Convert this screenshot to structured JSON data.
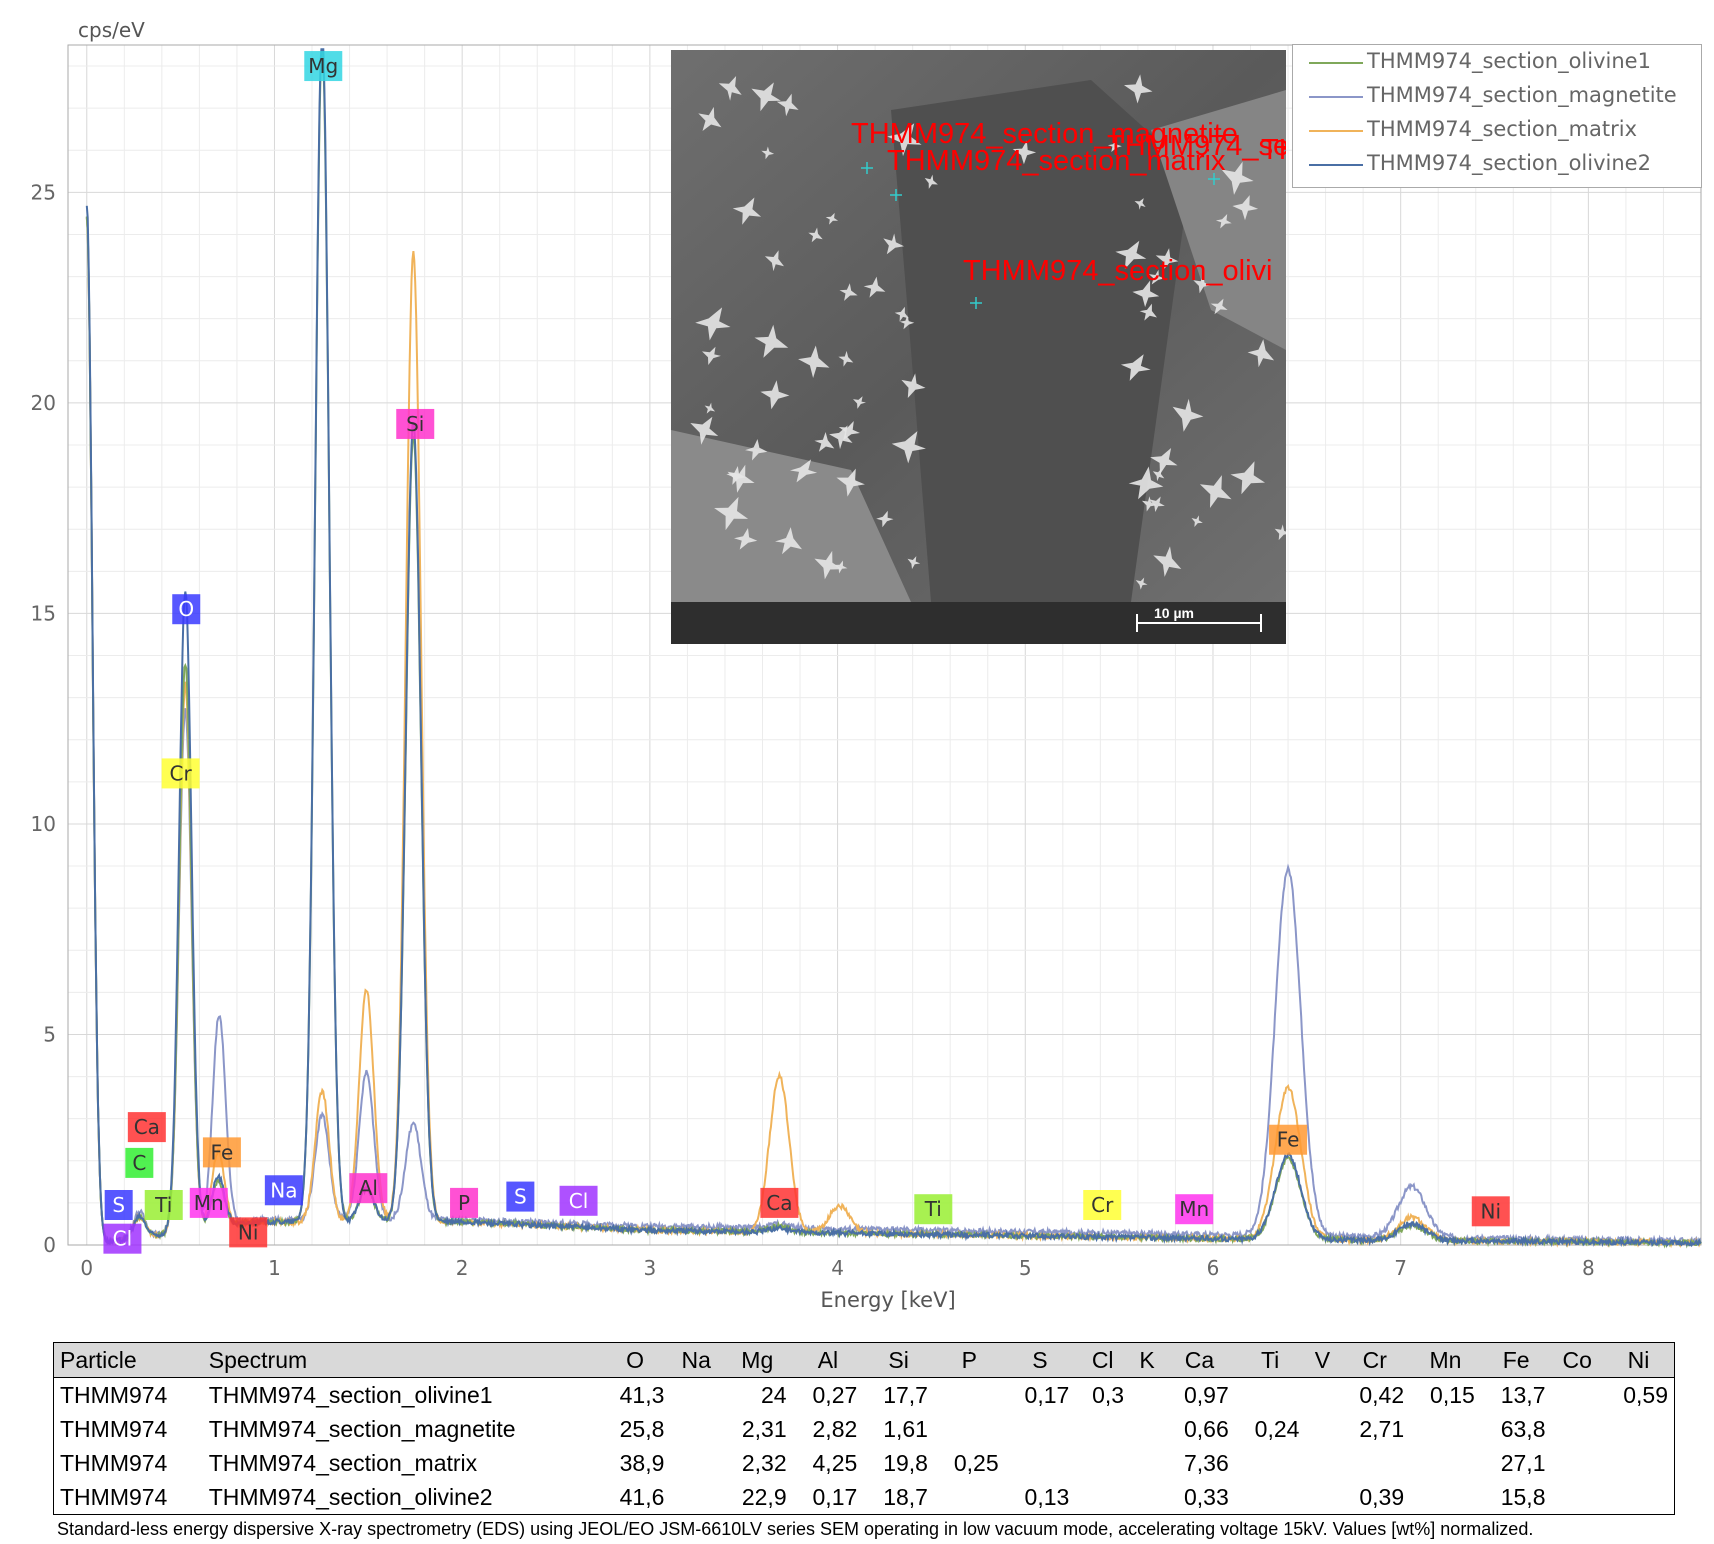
{
  "chart_data": {
    "type": "line",
    "ylabel": "cps/eV",
    "xlabel": "Energy [keV]",
    "xlim": [
      -0.1,
      8.6
    ],
    "ylim": [
      0,
      28.5
    ],
    "x_ticks": [
      "0",
      "1",
      "2",
      "3",
      "4",
      "5",
      "6",
      "7",
      "8"
    ],
    "y_ticks": [
      "0",
      "5",
      "10",
      "15",
      "20",
      "25"
    ],
    "grid": true,
    "legend_position": "top-right",
    "series": [
      {
        "name": "THMM974_section_olivine1",
        "color": "#7fa85a",
        "peaks": [
          [
            0,
            24.4
          ],
          [
            0.28,
            0.5
          ],
          [
            0.525,
            13.5
          ],
          [
            0.7,
            1.1
          ],
          [
            1.254,
            28.0
          ],
          [
            1.49,
            0.8
          ],
          [
            1.74,
            18.7
          ],
          [
            3.69,
            0.15
          ],
          [
            6.4,
            1.9
          ],
          [
            7.06,
            0.35
          ]
        ],
        "background": [
          [
            0.9,
            0.55
          ],
          [
            2.0,
            0.55
          ],
          [
            3.0,
            0.35
          ],
          [
            4.5,
            0.25
          ],
          [
            6.0,
            0.15
          ],
          [
            8.6,
            0.05
          ]
        ]
      },
      {
        "name": "THMM974_section_magnetite",
        "color": "#8b96c8",
        "peaks": [
          [
            0,
            24.4
          ],
          [
            0.28,
            0.6
          ],
          [
            0.525,
            12.4
          ],
          [
            0.705,
            5.0
          ],
          [
            1.254,
            2.5
          ],
          [
            1.49,
            3.5
          ],
          [
            1.74,
            2.3
          ],
          [
            3.69,
            0.1
          ],
          [
            6.4,
            8.7
          ],
          [
            7.06,
            1.2
          ]
        ],
        "background": [
          [
            0.9,
            0.6
          ],
          [
            2.0,
            0.6
          ],
          [
            3.0,
            0.45
          ],
          [
            4.5,
            0.35
          ],
          [
            6.0,
            0.25
          ],
          [
            8.6,
            0.1
          ]
        ]
      },
      {
        "name": "THMM974_section_matrix",
        "color": "#f0b35a",
        "peaks": [
          [
            0,
            24.4
          ],
          [
            0.28,
            0.5
          ],
          [
            0.525,
            13.0
          ],
          [
            0.7,
            1.8
          ],
          [
            1.254,
            3.1
          ],
          [
            1.49,
            5.5
          ],
          [
            1.74,
            23.0
          ],
          [
            3.69,
            3.7
          ],
          [
            4.01,
            0.65
          ],
          [
            6.4,
            3.6
          ],
          [
            7.06,
            0.55
          ]
        ],
        "background": [
          [
            0.9,
            0.55
          ],
          [
            2.0,
            0.55
          ],
          [
            3.0,
            0.35
          ],
          [
            4.5,
            0.25
          ],
          [
            6.0,
            0.15
          ],
          [
            8.6,
            0.05
          ]
        ]
      },
      {
        "name": "THMM974_section_olivine2",
        "color": "#4a6fa5",
        "peaks": [
          [
            0,
            24.7
          ],
          [
            0.28,
            0.5
          ],
          [
            0.525,
            15.2
          ],
          [
            0.7,
            1.2
          ],
          [
            1.254,
            28.3
          ],
          [
            1.49,
            0.8
          ],
          [
            1.74,
            19.0
          ],
          [
            3.69,
            0.1
          ],
          [
            6.4,
            2.0
          ],
          [
            7.06,
            0.4
          ]
        ],
        "background": [
          [
            0.9,
            0.55
          ],
          [
            2.0,
            0.55
          ],
          [
            3.0,
            0.35
          ],
          [
            4.5,
            0.25
          ],
          [
            6.0,
            0.15
          ],
          [
            8.6,
            0.05
          ]
        ]
      }
    ],
    "element_markers": [
      {
        "label": "Mg",
        "x": 1.26,
        "y": 28.0,
        "color": "#33d6e3"
      },
      {
        "label": "Si",
        "x": 1.75,
        "y": 19.5,
        "color": "#ff33cc"
      },
      {
        "label": "O",
        "x": 0.53,
        "y": 15.1,
        "color": "#3a3aff"
      },
      {
        "label": "Cr",
        "x": 0.5,
        "y": 11.2,
        "color": "#ffff33"
      },
      {
        "label": "Ca",
        "x": 0.32,
        "y": 2.8,
        "color": "#ff3333"
      },
      {
        "label": "Fe",
        "x": 0.72,
        "y": 2.2,
        "color": "#ff9933"
      },
      {
        "label": "C",
        "x": 0.28,
        "y": 1.95,
        "color": "#33ee33"
      },
      {
        "label": "Na",
        "x": 1.05,
        "y": 1.3,
        "color": "#3a3aff"
      },
      {
        "label": "Al",
        "x": 1.5,
        "y": 1.35,
        "color": "#ff33cc"
      },
      {
        "label": "Ti",
        "x": 0.41,
        "y": 0.95,
        "color": "#99ee33"
      },
      {
        "label": "S",
        "x": 0.17,
        "y": 0.95,
        "color": "#3a3aff"
      },
      {
        "label": "Mn",
        "x": 0.65,
        "y": 1.0,
        "color": "#ff33ee"
      },
      {
        "label": "Cl",
        "x": 0.19,
        "y": 0.15,
        "color": "#a033ff"
      },
      {
        "label": "Ni",
        "x": 0.86,
        "y": 0.3,
        "color": "#ff3333"
      },
      {
        "label": "P",
        "x": 2.01,
        "y": 1.0,
        "color": "#ff33cc"
      },
      {
        "label": "S",
        "x": 2.31,
        "y": 1.15,
        "color": "#3a3aff"
      },
      {
        "label": "Cl",
        "x": 2.62,
        "y": 1.05,
        "color": "#a033ff"
      },
      {
        "label": "Ca",
        "x": 3.69,
        "y": 1.0,
        "color": "#ff3333"
      },
      {
        "label": "Ti",
        "x": 4.51,
        "y": 0.85,
        "color": "#99ee33"
      },
      {
        "label": "Cr",
        "x": 5.41,
        "y": 0.95,
        "color": "#ffff33"
      },
      {
        "label": "Mn",
        "x": 5.9,
        "y": 0.85,
        "color": "#ff33ee"
      },
      {
        "label": "Fe",
        "x": 6.4,
        "y": 2.5,
        "color": "#ff9933"
      },
      {
        "label": "Ni",
        "x": 7.48,
        "y": 0.8,
        "color": "#ff3333"
      }
    ]
  },
  "sem_image": {
    "labels": [
      "THMM974_section_magnetite",
      "THMM974_section_matrix",
      "THMM974_section_olivi",
      "THMM974_se",
      "THMM974_se"
    ],
    "scale_bar": "10 µm"
  },
  "table": {
    "headers": [
      "Particle",
      "Spectrum",
      "O",
      "Na",
      "Mg",
      "Al",
      "Si",
      "P",
      "S",
      "Cl",
      "K",
      "Ca",
      "Ti",
      "V",
      "Cr",
      "Mn",
      "Fe",
      "Co",
      "Ni"
    ],
    "rows": [
      [
        "THMM974",
        "THMM974_section_olivine1",
        "41,3",
        "",
        "24",
        "0,27",
        "17,7",
        "",
        "0,17",
        "0,3",
        "",
        "0,97",
        "",
        "",
        "0,42",
        "0,15",
        "13,7",
        "",
        "0,59"
      ],
      [
        "THMM974",
        "THMM974_section_magnetite",
        "25,8",
        "",
        "2,31",
        "2,82",
        "1,61",
        "",
        "",
        "",
        "",
        "0,66",
        "0,24",
        "",
        "2,71",
        "",
        "63,8",
        "",
        ""
      ],
      [
        "THMM974",
        "THMM974_section_matrix",
        "38,9",
        "",
        "2,32",
        "4,25",
        "19,8",
        "0,25",
        "",
        "",
        "",
        "7,36",
        "",
        "",
        "",
        "",
        "27,1",
        "",
        ""
      ],
      [
        "THMM974",
        "THMM974_section_olivine2",
        "41,6",
        "",
        "22,9",
        "0,17",
        "18,7",
        "",
        "0,13",
        "",
        "",
        "0,33",
        "",
        "",
        "0,39",
        "",
        "15,8",
        "",
        ""
      ]
    ]
  },
  "caption": "Standard-less energy dispersive X-ray spectrometry (EDS) using JEOL/EO JSM-6610LV series SEM operating in low vacuum mode, accelerating voltage 15kV. Values [wt%] normalized."
}
